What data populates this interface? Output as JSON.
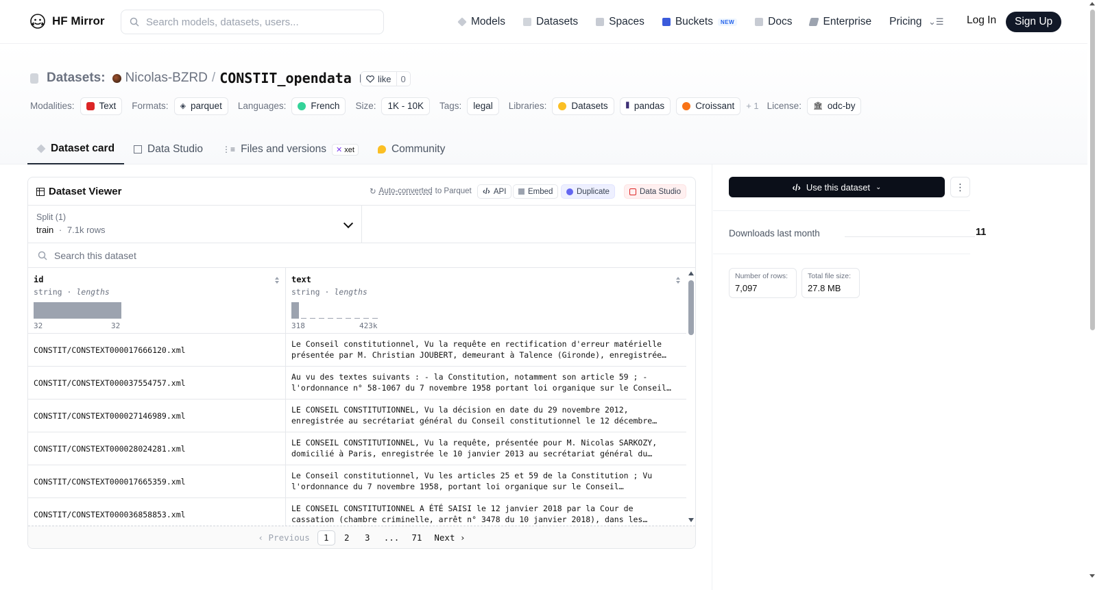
{
  "brand": {
    "name": "HF Mirror"
  },
  "search": {
    "placeholder": "Search models, datasets, users..."
  },
  "nav": {
    "models": "Models",
    "datasets": "Datasets",
    "spaces": "Spaces",
    "buckets": "Buckets",
    "buckets_badge": "NEW",
    "docs": "Docs",
    "enterprise": "Enterprise",
    "pricing": "Pricing",
    "login": "Log In",
    "signup": "Sign Up"
  },
  "repo": {
    "prefix": "Datasets:",
    "owner": "Nicolas-BZRD",
    "slash": "/",
    "name": "CONSTIT_opendata",
    "like_label": "like",
    "like_count": "0"
  },
  "meta": {
    "modalities_label": "Modalities:",
    "modality": "Text",
    "formats_label": "Formats:",
    "format": "parquet",
    "languages_label": "Languages:",
    "language": "French",
    "size_label": "Size:",
    "size": "1K - 10K",
    "tags_label": "Tags:",
    "tag": "legal",
    "libraries_label": "Libraries:",
    "lib1": "Datasets",
    "lib2": "pandas",
    "lib3": "Croissant",
    "libs_more": "+ 1",
    "license_label": "License:",
    "license": "odc-by"
  },
  "tabs": {
    "card": "Dataset card",
    "studio": "Data Studio",
    "files": "Files and versions",
    "xet": "xet",
    "community": "Community"
  },
  "viewer": {
    "title": "Dataset Viewer",
    "auto_link": "Auto-converted",
    "auto_rest": "to Parquet",
    "api": "API",
    "embed": "Embed",
    "duplicate": "Duplicate",
    "studio": "Data Studio",
    "split_label": "Split (1)",
    "split_name": "train",
    "split_sep": "·",
    "split_rows": "7.1k rows",
    "search_placeholder": "Search this dataset",
    "columns": [
      {
        "name": "id",
        "type": "string",
        "sep": "·",
        "kind": "lengths",
        "min": "32",
        "max": "32"
      },
      {
        "name": "text",
        "type": "string",
        "sep": "·",
        "kind": "lengths",
        "min": "318",
        "max": "423k"
      }
    ],
    "rows": [
      {
        "id": "CONSTIT/CONSTEXT000017666120.xml",
        "l1": "Le Conseil constitutionnel, Vu la requête en rectification d'erreur matérielle",
        "l2": "présentée par M. Christian JOUBERT, demeurant à Talence (Gironde), enregistrée…"
      },
      {
        "id": "CONSTIT/CONSTEXT000037554757.xml",
        "l1": "Au vu des textes suivants : - la Constitution, notamment son article 59 ; -",
        "l2": "l'ordonnance n° 58-1067 du 7 novembre 1958 portant loi organique sur le Conseil…"
      },
      {
        "id": "CONSTIT/CONSTEXT000027146989.xml",
        "l1": "LE CONSEIL CONSTITUTIONNEL, Vu la décision en date du 29 novembre 2012,",
        "l2": "enregistrée au secrétariat général du Conseil constitutionnel le 12 décembre…"
      },
      {
        "id": "CONSTIT/CONSTEXT000028024281.xml",
        "l1": "LE CONSEIL CONSTITUTIONNEL, Vu la requête, présentée pour M. Nicolas SARKOZY,",
        "l2": "domicilié à Paris, enregistrée le 10 janvier 2013 au secrétariat général du…"
      },
      {
        "id": "CONSTIT/CONSTEXT000017665359.xml",
        "l1": "Le Conseil constitutionnel, Vu les articles 25 et 59 de la Constitution ; Vu",
        "l2": "l'ordonnance du 7 novembre 1958, portant loi organique sur le Conseil…"
      },
      {
        "id": "CONSTIT/CONSTEXT000036858853.xml",
        "l1": "LE CONSEIL CONSTITUTIONNEL A ÉTÉ SAISI le 12 janvier 2018 par la Cour de",
        "l2": "cassation (chambre criminelle, arrêt n° 3478 du 10 janvier 2018), dans les…"
      }
    ],
    "pager": {
      "prev": "Previous",
      "p1": "1",
      "p2": "2",
      "p3": "3",
      "ellipsis": "...",
      "last": "71",
      "next": "Next"
    }
  },
  "sidebar": {
    "use_button": "Use this dataset",
    "downloads_label": "Downloads last month",
    "downloads_value": "11",
    "rows_label": "Number of rows:",
    "rows_value": "7,097",
    "filesize_label": "Total file size:",
    "filesize_value": "27.8 MB"
  }
}
